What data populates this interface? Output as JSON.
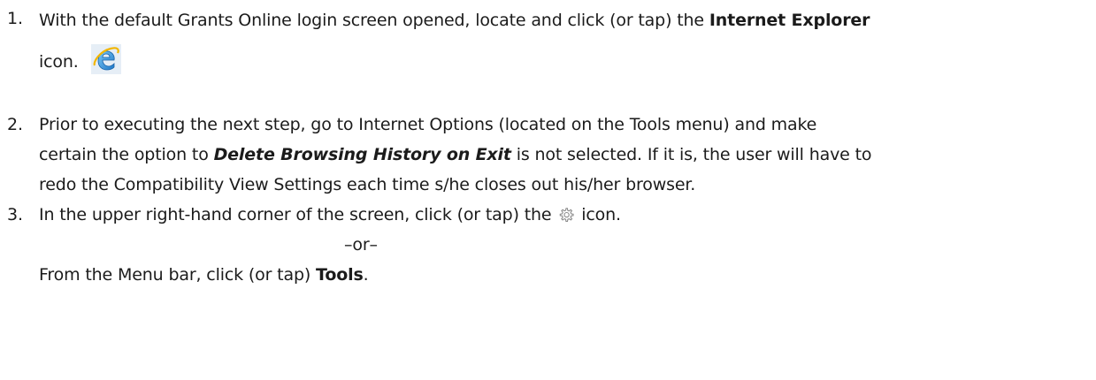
{
  "steps": [
    {
      "number": "1.",
      "text_1": "With the default Grants Online login screen opened, locate and click (or tap) the ",
      "bold_1": "Internet Explorer",
      "text_2": "icon.",
      "icon": "internet-explorer-icon"
    },
    {
      "number": "2.",
      "text_1": "Prior to executing the next step, go to Internet Options (located on the Tools menu) and make",
      "text_2": "certain the option to ",
      "bold_italic": "Delete Browsing History on Exit",
      "text_3": " is not selected. If it is, the user will have to",
      "text_4": "redo the Compatibility View Settings each time s/he closes out his/her browser."
    },
    {
      "number": "3.",
      "text_1": "In the upper right-hand corner of the screen, click (or tap) the ",
      "icon": "gear-icon",
      "text_2": " icon.",
      "or": "–or–",
      "text_3": "From the Menu bar, click (or tap) ",
      "bold": "Tools",
      "text_4": "."
    }
  ],
  "colors": {
    "text": "#1b1b1b",
    "ie_blue": "#2f8fd8",
    "ie_gold": "#f2b600"
  }
}
